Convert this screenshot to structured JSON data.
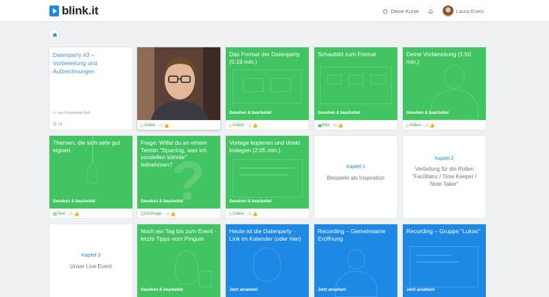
{
  "header": {
    "logo": "blink.it",
    "courses_label": "Deine Kurse",
    "user_name": "Laura Evers"
  },
  "cards": {
    "c1": {
      "title": "Datenparty #3 – Vorbereitung und Aufzeichnungen",
      "author": "von Konstantin Ridl",
      "count": "14"
    },
    "c2": {
      "type": "Video",
      "meta": "3"
    },
    "c3": {
      "title": "Das Format der Datenparty (5:19 min.)",
      "status": "Gesehen & bearbeitet",
      "type": "Video",
      "meta": "2"
    },
    "c4": {
      "title": "Schaubild zum Format",
      "status": "Gesehen & bearbeitet",
      "type": "Bild",
      "meta": "0"
    },
    "c5": {
      "title": "Deine Vorbereitung (1:50 min.)",
      "status": "Gesehen & bearbeitet",
      "type": "Video",
      "meta": "0"
    },
    "c6": {
      "title": "Themen, die sich sehr gut eignen",
      "status": "Gesehen & bearbeitet",
      "type": "Text",
      "meta": "0"
    },
    "c7": {
      "title": "Frage: Willst du an einem Termin \"Sparring, was ich vorstellen könnte\" teilnehmen?",
      "status": "Gesehen & bearbeitet",
      "type": "Umfrage",
      "meta": "0"
    },
    "c8": {
      "title": "Vorlage kopieren und direkt loslegen (2:05 min.)",
      "status": "Gesehen & bearbeitet",
      "type": "Video",
      "meta": "0"
    },
    "c9": {
      "label": "Kapitel 1",
      "name": "Beispiele als Inspiration"
    },
    "c10": {
      "label": "Kapitel 2",
      "name": "Vertiefung für die Rollen \"Facilitator / Time Keeper / Note Taker\""
    },
    "c11": {
      "label": "Kapitel 3",
      "name": "Unser Live Event"
    },
    "c12": {
      "title": "Noch ein Tag bis zum Event - letzte Tipps vom Pinguin",
      "status": "Gesehen & bearbeitet"
    },
    "c13": {
      "title": "Heute ist die Datenparty - Link im Kalender (oder hier)",
      "status": "Jetzt ansehen!"
    },
    "c14": {
      "title": "Recording – Gemeinsame Eröffnung",
      "status": "Jetzt ansehen!"
    },
    "c15": {
      "title": "Recording – Gruppe \"Lukas\"",
      "status": "Jetzt ansehen!"
    }
  },
  "colors": {
    "green": "#43c463",
    "blue": "#1e88e5",
    "accent": "#4a90d9"
  }
}
